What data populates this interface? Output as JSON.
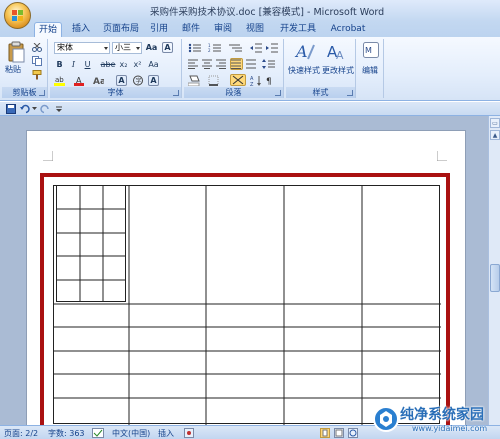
{
  "window": {
    "title": "采购件采购技术协议.doc [兼容模式] - Microsoft Word"
  },
  "tabs": [
    "开始",
    "插入",
    "页面布局",
    "引用",
    "邮件",
    "审阅",
    "视图",
    "开发工具",
    "Acrobat"
  ],
  "ribbon": {
    "clipboard": {
      "label": "剪贴板",
      "paste": "粘贴"
    },
    "font": {
      "label": "字体",
      "font_name": "宋体",
      "font_size": "小三",
      "bold": "B",
      "italic": "I",
      "underline": "U",
      "strike": "abe",
      "subscript": "x₂",
      "superscript": "x²",
      "font_color_letter": "A",
      "size_letter": "Aa"
    },
    "paragraph": {
      "label": "段落"
    },
    "styles": {
      "label": "样式",
      "quick_styles": "快速样式",
      "change_styles": "更改样式"
    },
    "editing": {
      "label": "编辑"
    }
  },
  "status": {
    "page": "页面: 2/2",
    "words": "字数: 363",
    "language": "中文(中国)",
    "mode": "插入"
  },
  "watermark": {
    "brand": "纯净系统家园",
    "url": "www.yidaimei.com"
  },
  "colors": {
    "highlight_border": "#aa1111",
    "ribbon_blue": "#15428b"
  }
}
